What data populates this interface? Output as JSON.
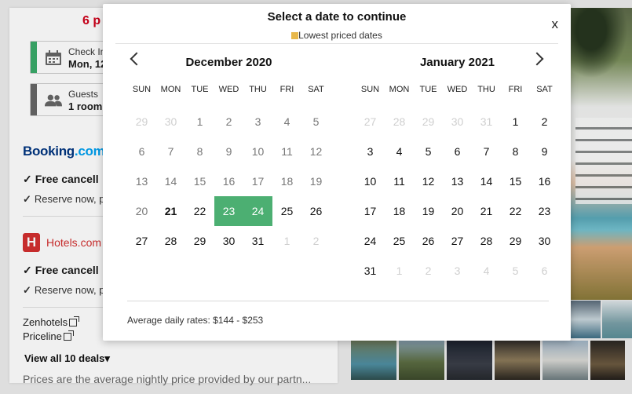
{
  "left_panel": {
    "count_title": "6 p",
    "checkin": {
      "label": "Check In",
      "value": "Mon, 12",
      "bar_color": "#3aaa6a"
    },
    "guests": {
      "label": "Guests",
      "value": "1 room",
      "bar_color": "#666666"
    },
    "providers": [
      {
        "logo_main": "Booking",
        "logo_suffix": ".com",
        "feature": "Free cancell",
        "note": "Reserve now, p"
      },
      {
        "logo_mark": "H",
        "logo_text": "Hotels.com",
        "feature": "Free cancell",
        "note": "Reserve now, p"
      }
    ],
    "deal_links": [
      "Zenhotels",
      "Priceline"
    ],
    "view_all": "View all 10 deals",
    "view_all_caret": "▾",
    "disclaimer": "Prices are the average nightly price provided by our partn..."
  },
  "check_glyph": "✓",
  "modal": {
    "title": "Select a date to continue",
    "close_label": "x",
    "legend_label": "Lowest priced dates",
    "legend_color": "#e8b84a",
    "selected_color": "#4caf72",
    "footer": "Average daily rates: $144 - $253",
    "weekdays": [
      "SUN",
      "MON",
      "TUE",
      "WED",
      "THU",
      "FRI",
      "SAT"
    ],
    "months": [
      {
        "title": "December 2020",
        "days": [
          {
            "d": "29",
            "s": "muted"
          },
          {
            "d": "30",
            "s": "muted"
          },
          {
            "d": "1",
            "s": "past"
          },
          {
            "d": "2",
            "s": "past"
          },
          {
            "d": "3",
            "s": "past"
          },
          {
            "d": "4",
            "s": "past"
          },
          {
            "d": "5",
            "s": "past"
          },
          {
            "d": "6",
            "s": "past"
          },
          {
            "d": "7",
            "s": "past"
          },
          {
            "d": "8",
            "s": "past"
          },
          {
            "d": "9",
            "s": "past"
          },
          {
            "d": "10",
            "s": "past"
          },
          {
            "d": "11",
            "s": "past"
          },
          {
            "d": "12",
            "s": "past"
          },
          {
            "d": "13",
            "s": "past"
          },
          {
            "d": "14",
            "s": "past"
          },
          {
            "d": "15",
            "s": "past"
          },
          {
            "d": "16",
            "s": "past"
          },
          {
            "d": "17",
            "s": "past"
          },
          {
            "d": "18",
            "s": "past"
          },
          {
            "d": "19",
            "s": "past"
          },
          {
            "d": "20",
            "s": "past"
          },
          {
            "d": "21",
            "s": "today"
          },
          {
            "d": "22",
            "s": ""
          },
          {
            "d": "23",
            "s": "sel"
          },
          {
            "d": "24",
            "s": "sel"
          },
          {
            "d": "25",
            "s": ""
          },
          {
            "d": "26",
            "s": ""
          },
          {
            "d": "27",
            "s": ""
          },
          {
            "d": "28",
            "s": ""
          },
          {
            "d": "29",
            "s": ""
          },
          {
            "d": "30",
            "s": ""
          },
          {
            "d": "31",
            "s": ""
          },
          {
            "d": "1",
            "s": "muted"
          },
          {
            "d": "2",
            "s": "muted"
          }
        ]
      },
      {
        "title": "January 2021",
        "days": [
          {
            "d": "27",
            "s": "muted"
          },
          {
            "d": "28",
            "s": "muted"
          },
          {
            "d": "29",
            "s": "muted"
          },
          {
            "d": "30",
            "s": "muted"
          },
          {
            "d": "31",
            "s": "muted"
          },
          {
            "d": "1",
            "s": ""
          },
          {
            "d": "2",
            "s": ""
          },
          {
            "d": "3",
            "s": ""
          },
          {
            "d": "4",
            "s": ""
          },
          {
            "d": "5",
            "s": ""
          },
          {
            "d": "6",
            "s": ""
          },
          {
            "d": "7",
            "s": ""
          },
          {
            "d": "8",
            "s": ""
          },
          {
            "d": "9",
            "s": ""
          },
          {
            "d": "10",
            "s": ""
          },
          {
            "d": "11",
            "s": ""
          },
          {
            "d": "12",
            "s": ""
          },
          {
            "d": "13",
            "s": ""
          },
          {
            "d": "14",
            "s": ""
          },
          {
            "d": "15",
            "s": ""
          },
          {
            "d": "16",
            "s": ""
          },
          {
            "d": "17",
            "s": ""
          },
          {
            "d": "18",
            "s": ""
          },
          {
            "d": "19",
            "s": ""
          },
          {
            "d": "20",
            "s": ""
          },
          {
            "d": "21",
            "s": ""
          },
          {
            "d": "22",
            "s": ""
          },
          {
            "d": "23",
            "s": ""
          },
          {
            "d": "24",
            "s": ""
          },
          {
            "d": "25",
            "s": ""
          },
          {
            "d": "26",
            "s": ""
          },
          {
            "d": "27",
            "s": ""
          },
          {
            "d": "28",
            "s": ""
          },
          {
            "d": "29",
            "s": ""
          },
          {
            "d": "30",
            "s": ""
          },
          {
            "d": "31",
            "s": ""
          },
          {
            "d": "1",
            "s": "muted"
          },
          {
            "d": "2",
            "s": "muted"
          },
          {
            "d": "3",
            "s": "muted"
          },
          {
            "d": "4",
            "s": "muted"
          },
          {
            "d": "5",
            "s": "muted"
          },
          {
            "d": "6",
            "s": "muted"
          }
        ]
      }
    ]
  }
}
